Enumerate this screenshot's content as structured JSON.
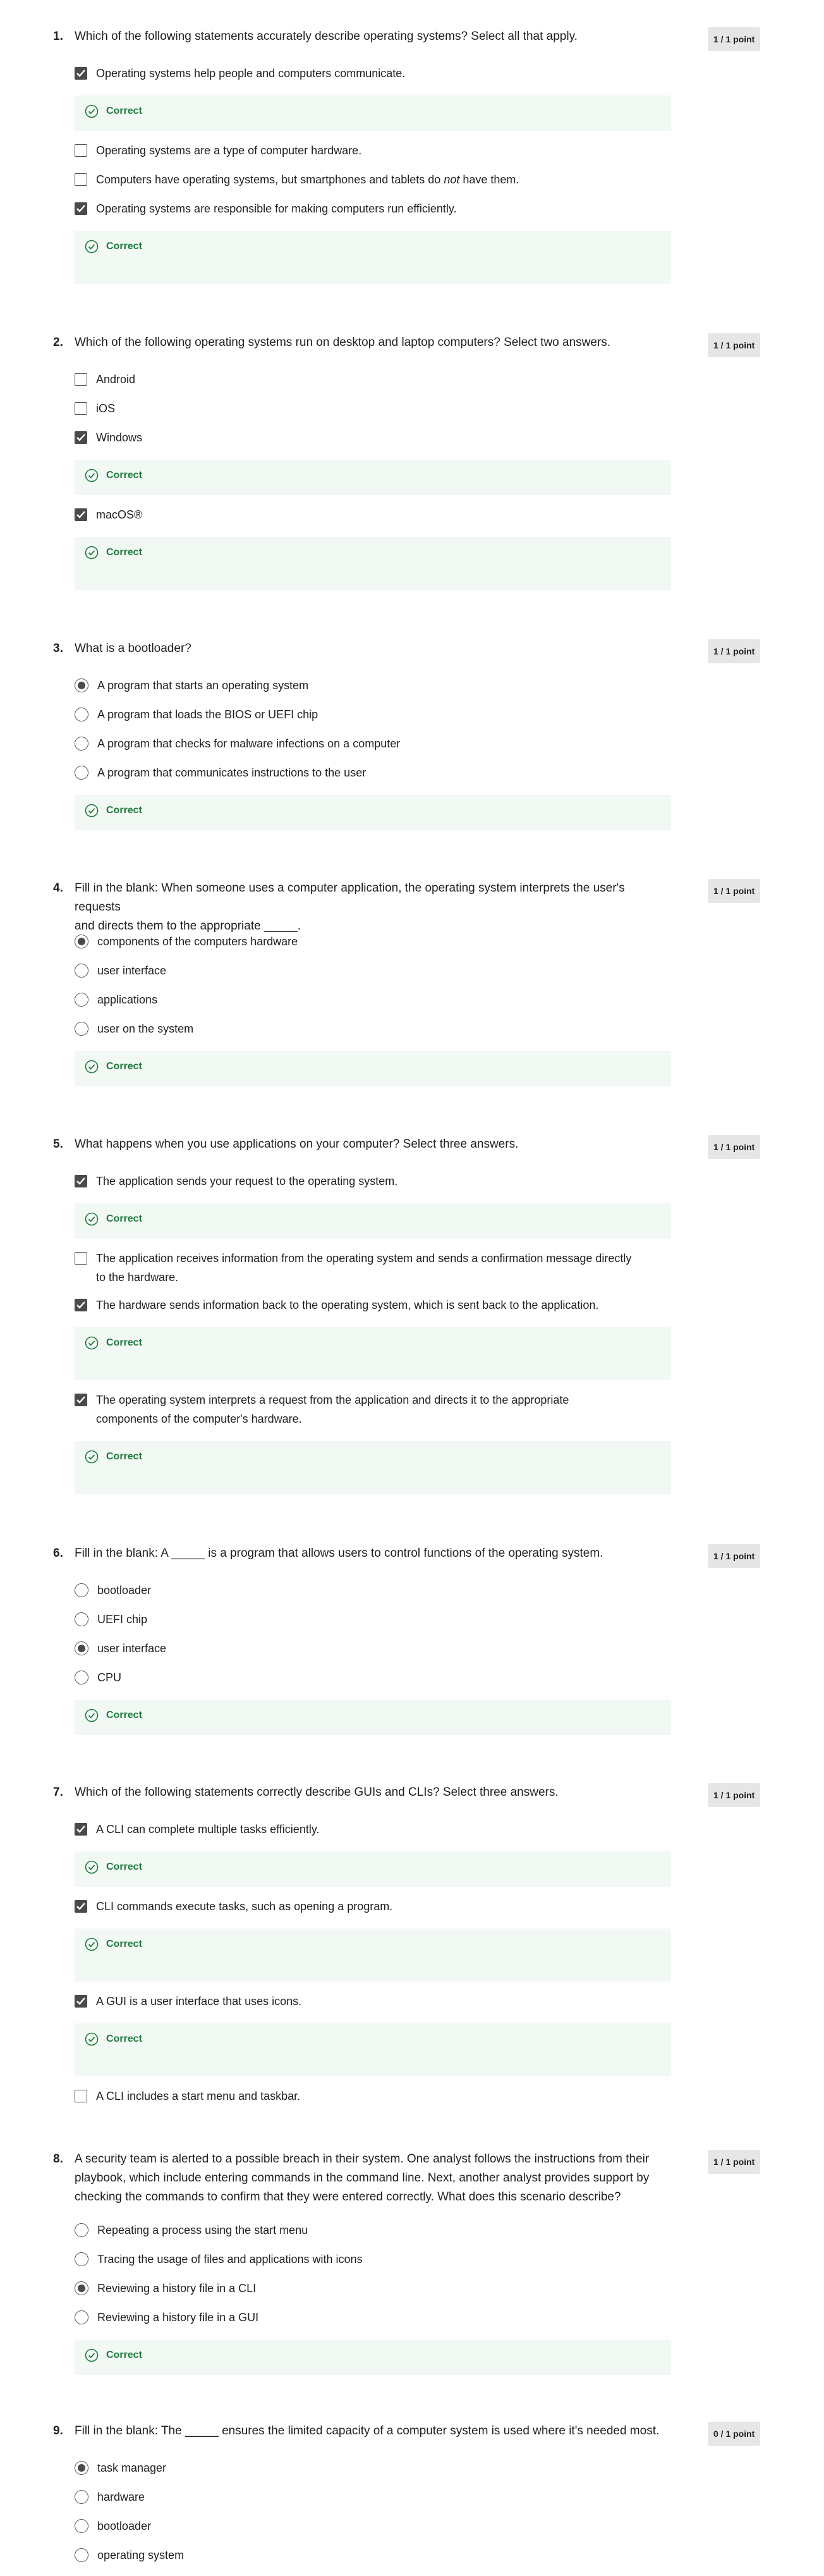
{
  "colors": {
    "correct": "#1e7a3c",
    "feedback_bg": "#f2f8f4",
    "points_bg": "#e6e6e6"
  },
  "icons": {
    "feedback": "check-circle-icon",
    "checkbox": "checkbox-icon",
    "radio": "radio-icon"
  },
  "questions": [
    {
      "number": "1.",
      "points": "1 / 1 point",
      "text": [
        "Which of the following statements accurately describe operating systems? Select all that apply."
      ],
      "options": [
        {
          "label": "Operating systems help people and computers communicate.",
          "selected": true,
          "feedback": "Correct"
        },
        {
          "label": "Operating systems are a type of computer hardware.",
          "selected": false
        },
        {
          "label_parts": [
            "Computers have operating systems, but smartphones and tablets do ",
            "not",
            " have them."
          ],
          "selected": false
        },
        {
          "label": "Operating systems are responsible for making computers run efficiently.",
          "selected": true,
          "feedback": "Correct"
        }
      ]
    },
    {
      "number": "2.",
      "points": "1 / 1 point",
      "text": [
        "Which of the following operating systems run on desktop and laptop computers? Select two answers."
      ],
      "options": [
        {
          "label": "Android",
          "selected": false
        },
        {
          "label": "iOS",
          "selected": false
        },
        {
          "label": "Windows",
          "selected": true,
          "feedback": "Correct"
        },
        {
          "label": "macOS®",
          "selected": true,
          "feedback": "Correct"
        }
      ]
    },
    {
      "number": "3.",
      "points": "1 / 1 point",
      "text": [
        "What is a bootloader?"
      ],
      "options": [
        {
          "label": "A program that starts an operating system",
          "selected": true
        },
        {
          "label": "A program that loads the BIOS or UEFI chip",
          "selected": false
        },
        {
          "label": "A program that checks for malware infections on a computer",
          "selected": false
        },
        {
          "label": "A program that communicates instructions to the user",
          "selected": false
        }
      ],
      "feedback": "Correct"
    },
    {
      "number": "4.",
      "points": "1 / 1 point",
      "text": [
        "Fill in the blank: When someone uses a computer application, the operating system interprets the user's requests",
        "and directs them to the appropriate _____."
      ],
      "options": [
        {
          "label": "components of the computers hardware",
          "selected": true
        },
        {
          "label": "user interface",
          "selected": false
        },
        {
          "label": "applications",
          "selected": false
        },
        {
          "label": "user on the system",
          "selected": false
        }
      ],
      "feedback": "Correct"
    },
    {
      "number": "5.",
      "points": "1 / 1 point",
      "text": [
        "What happens when you use applications on your computer? Select three answers."
      ],
      "options": [
        {
          "label": "The application sends your request to the operating system.",
          "selected": true,
          "feedback": "Correct"
        },
        {
          "label_lines": [
            "The application receives information from the operating system and sends a confirmation message directly",
            "to the hardware."
          ],
          "selected": false
        },
        {
          "label": "The hardware sends information back to the operating system, which is sent back to the application.",
          "selected": true,
          "feedback": "Correct"
        },
        {
          "label_lines": [
            "The operating system interprets a request from the application and directs it to the appropriate",
            "components of the computer's hardware."
          ],
          "selected": true,
          "feedback": "Correct"
        }
      ]
    },
    {
      "number": "6.",
      "points": "1 / 1 point",
      "text": [
        "Fill in the blank: A _____ is a program that allows users to control functions of the operating system."
      ],
      "options": [
        {
          "label": "bootloader",
          "selected": false
        },
        {
          "label": "UEFI chip",
          "selected": false
        },
        {
          "label": "user interface",
          "selected": true
        },
        {
          "label": "CPU",
          "selected": false
        }
      ],
      "feedback": "Correct"
    },
    {
      "number": "7.",
      "points": "1 / 1 point",
      "text": [
        "Which of the following statements correctly describe GUIs and CLIs? Select three answers."
      ],
      "options": [
        {
          "label": "A CLI can complete multiple tasks efficiently.",
          "selected": true,
          "feedback": "Correct"
        },
        {
          "label": "CLI commands execute tasks, such as opening a program.",
          "selected": true,
          "feedback": "Correct"
        },
        {
          "label": "A GUI is a user interface that uses icons.",
          "selected": true,
          "feedback": "Correct"
        },
        {
          "label": "A CLI includes a start menu and taskbar.",
          "selected": false
        }
      ]
    },
    {
      "number": "8.",
      "points": "1 / 1 point",
      "text": [
        "A security team is alerted to a possible breach in their system. One analyst follows the instructions from their",
        "playbook, which include entering commands in the command line. Next, another analyst provides support by",
        "checking the commands to confirm that they were entered correctly. What does this scenario describe?"
      ],
      "options": [
        {
          "label": "Repeating a process using the start menu",
          "selected": false
        },
        {
          "label": "Tracing the usage of files and applications with icons",
          "selected": false
        },
        {
          "label": "Reviewing a history file in a CLI",
          "selected": true
        },
        {
          "label": "Reviewing a history file in a GUI",
          "selected": false
        }
      ],
      "feedback": "Correct"
    },
    {
      "number": "9.",
      "points": "0 / 1 point",
      "text": [
        "Fill in the blank: The _____ ensures the limited capacity of a computer system is used where it's needed most."
      ],
      "options": [
        {
          "label": "task manager",
          "selected": true
        },
        {
          "label": "hardware",
          "selected": false
        },
        {
          "label": "bootloader",
          "selected": false
        },
        {
          "label": "operating system",
          "selected": false
        }
      ]
    }
  ]
}
